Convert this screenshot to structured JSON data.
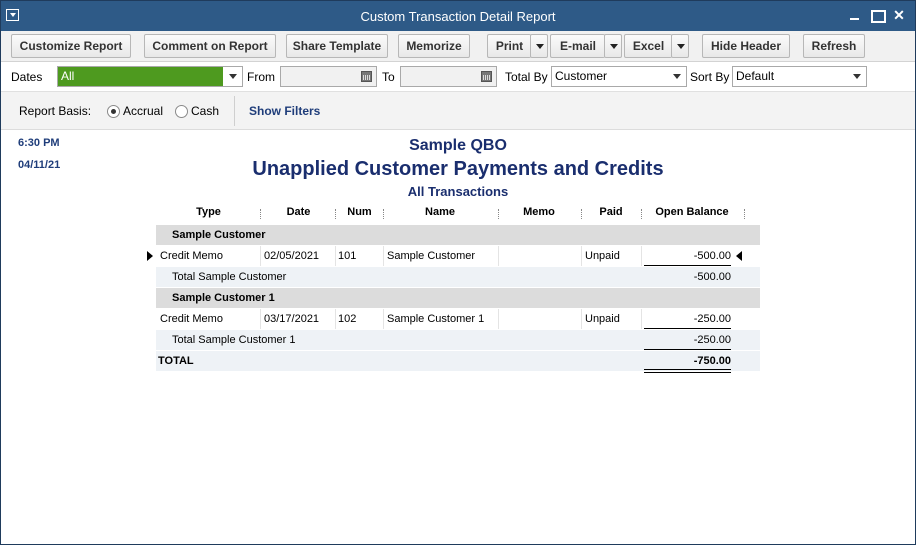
{
  "window": {
    "title": "Custom Transaction Detail Report",
    "controls": {
      "close": "✕"
    }
  },
  "toolbar": {
    "customize_report": "Customize Report",
    "comment_on_report": "Comment on Report",
    "share_template": "Share Template",
    "memorize": "Memorize",
    "print": "Print",
    "email": "E-mail",
    "excel": "Excel",
    "hide_header": "Hide Header",
    "refresh": "Refresh"
  },
  "filters": {
    "dates_label": "Dates",
    "dates_value": "All",
    "from_label": "From",
    "from_value": "",
    "to_label": "To",
    "to_value": "",
    "total_by_label": "Total By",
    "total_by_value": "Customer",
    "sort_by_label": "Sort By",
    "sort_by_value": "Default",
    "dates_highlight_color": "#4e9a1f"
  },
  "basis": {
    "label": "Report Basis:",
    "accrual": "Accrual",
    "cash": "Cash",
    "selected": "Accrual",
    "show_filters": "Show Filters"
  },
  "report": {
    "time": "6:30 PM",
    "date": "04/11/21",
    "company": "Sample QBO",
    "title": "Unapplied Customer Payments and Credits",
    "subtitle": "All Transactions",
    "columns": [
      "Type",
      "Date",
      "Num",
      "Name",
      "Memo",
      "Paid",
      "Open Balance"
    ],
    "groups": [
      {
        "name": "Sample Customer",
        "rows": [
          {
            "type": "Credit Memo",
            "date": "02/05/2021",
            "num": "101",
            "name": "Sample Customer",
            "memo": "",
            "paid": "Unpaid",
            "open_balance": "-500.00"
          }
        ],
        "total_label": "Total Sample Customer",
        "total": "-500.00"
      },
      {
        "name": "Sample Customer 1",
        "rows": [
          {
            "type": "Credit Memo",
            "date": "03/17/2021",
            "num": "102",
            "name": "Sample Customer 1",
            "memo": "",
            "paid": "Unpaid",
            "open_balance": "-250.00"
          }
        ],
        "total_label": "Total Sample Customer 1",
        "total": "-250.00"
      }
    ],
    "grand_total_label": "TOTAL",
    "grand_total": "-750.00",
    "title_color": "#1a2e6e"
  }
}
